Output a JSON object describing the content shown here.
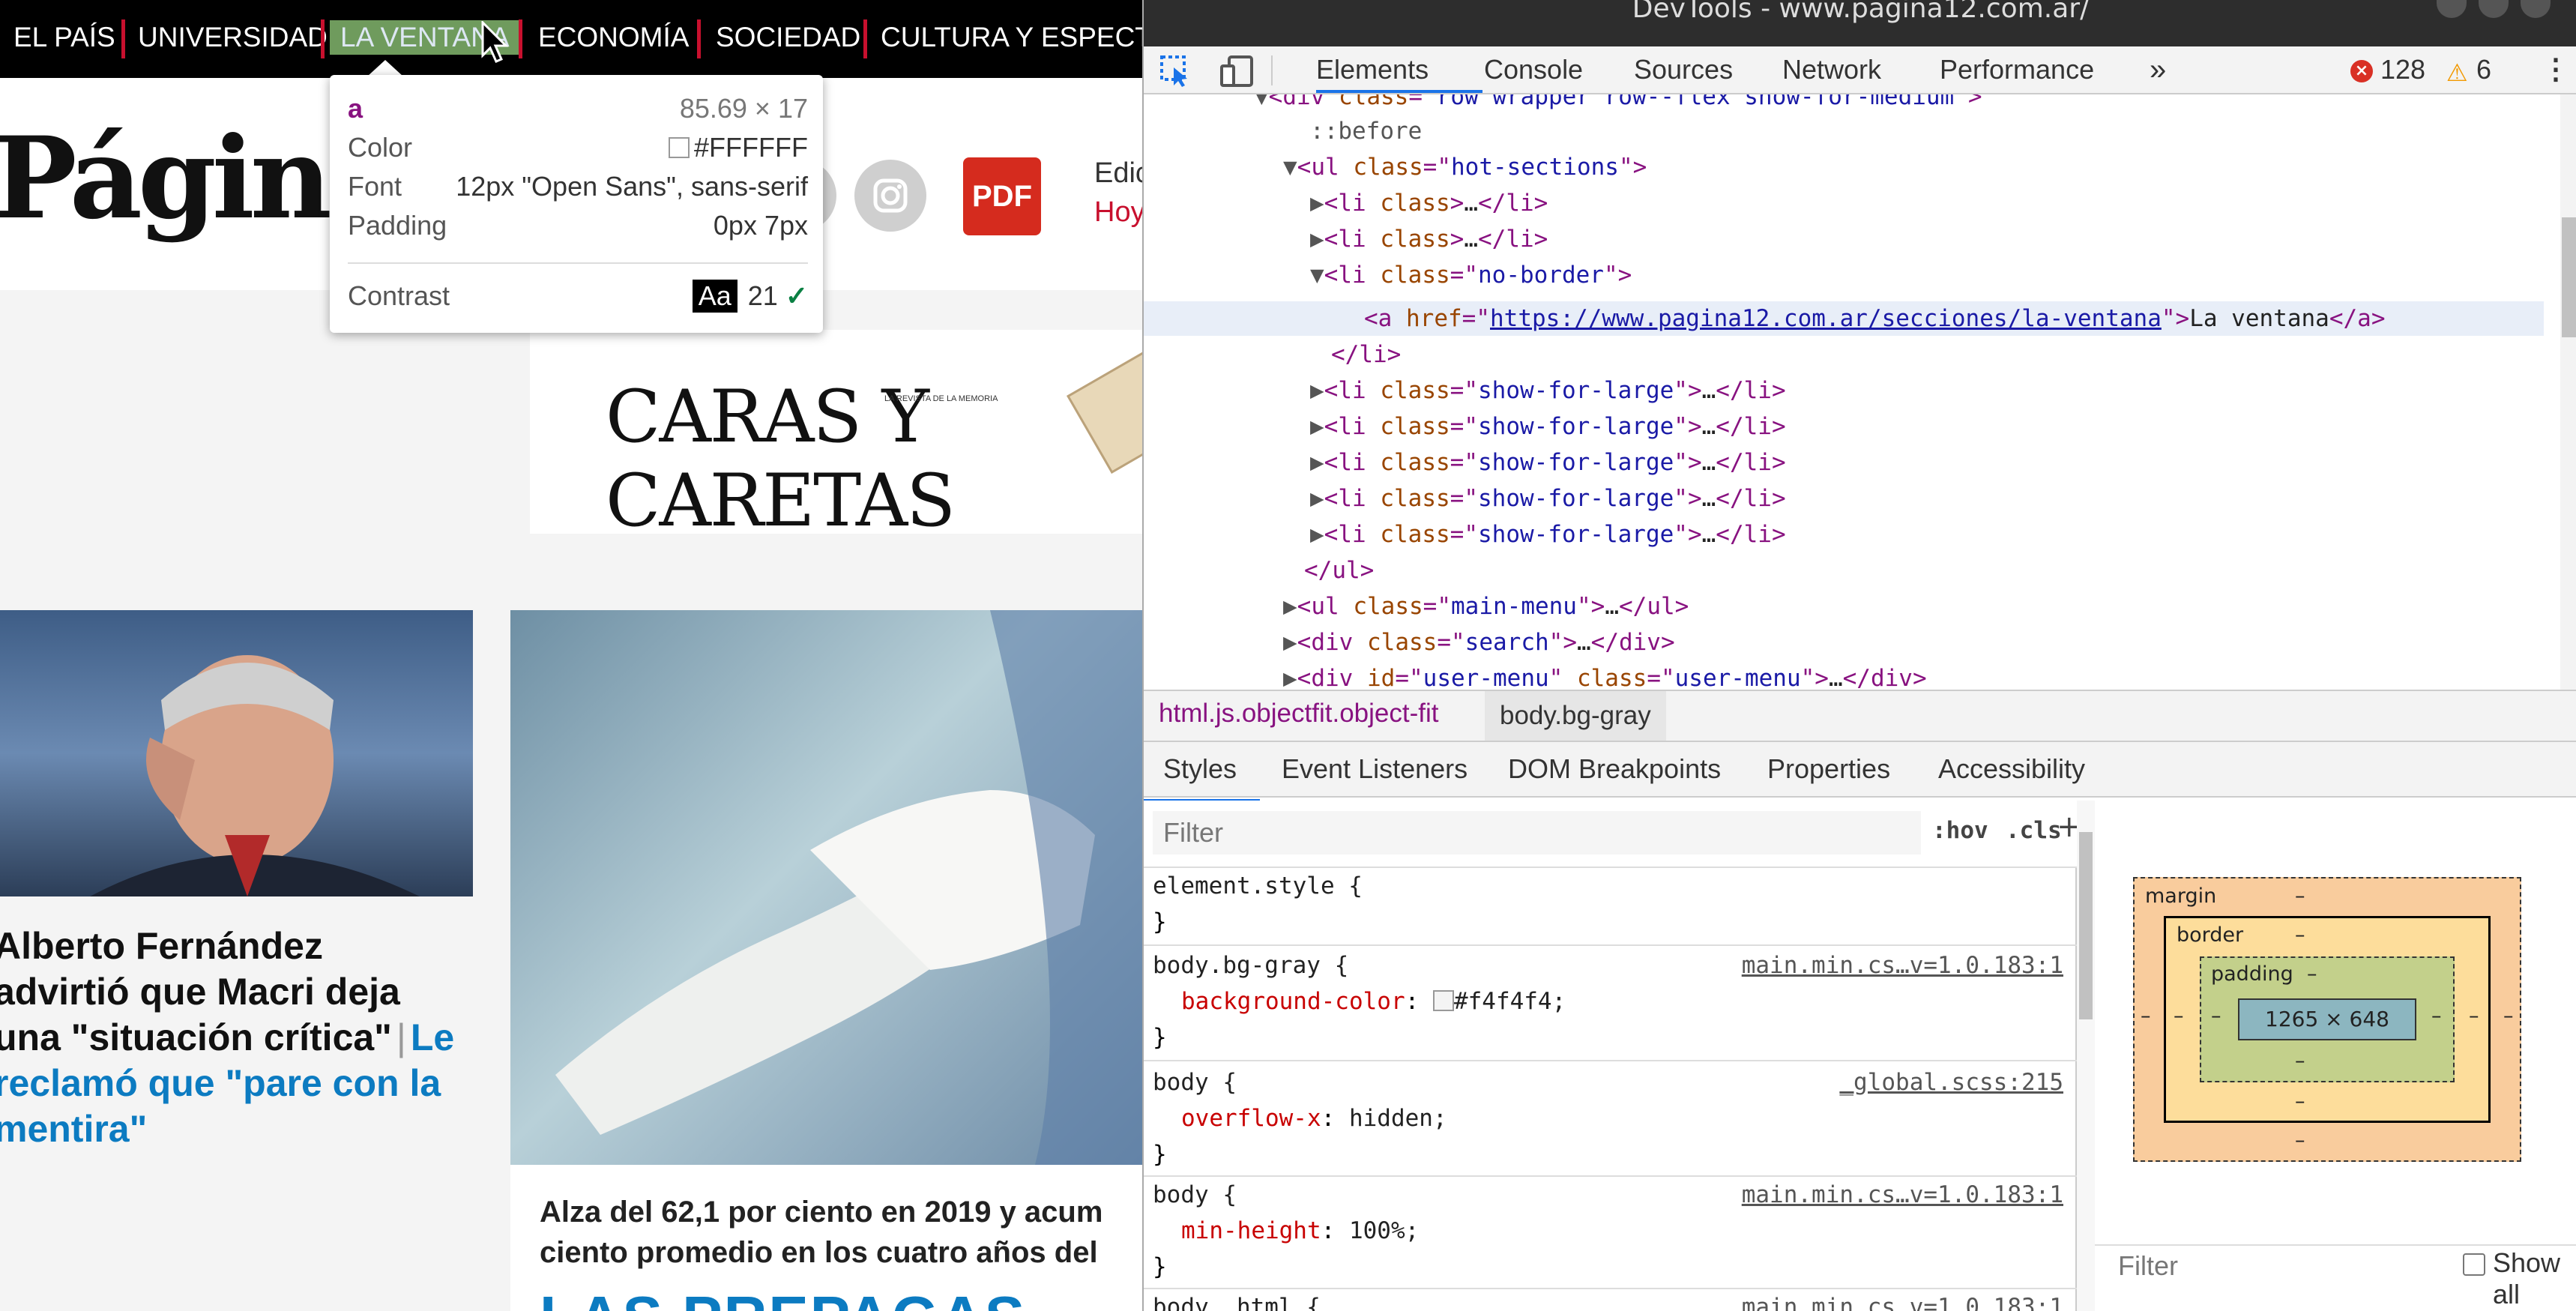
{
  "nav": {
    "items": [
      "EL PAÍS",
      "UNIVERSIDAD",
      "LA VENTANA",
      "ECONOMÍA",
      "SOCIEDAD",
      "CULTURA Y ESPECTÁ"
    ]
  },
  "masthead": {
    "logo": "Págin",
    "pdf_label": "PDF",
    "edition_label": "Edic",
    "edition_date": "Hoy"
  },
  "ad": {
    "brand": "CARAS Y CARETAS",
    "tagline": "LA REVISTA DE LA MEMORIA"
  },
  "articles": [
    {
      "headline": "Alberto Fernández advirtió que Macri deja una \"situación crítica\"",
      "related": "Le reclamó que \"pare con la mentira\""
    },
    {
      "lede": "Alza del 62,1 por ciento en 2019 y acum",
      "lede2": "ciento promedio en los cuatro años del",
      "headline": "LAS PREPAGAS"
    }
  ],
  "tooltip": {
    "tag": "a",
    "size": "85.69 × 17",
    "color_label": "Color",
    "color_value": "#FFFFFF",
    "font_label": "Font",
    "font_value": "12px \"Open Sans\", sans-serif",
    "padding_label": "Padding",
    "padding_value": "0px 7px",
    "contrast_label": "Contrast",
    "contrast_sample": "Aa",
    "contrast_value": "21"
  },
  "devtools": {
    "title": "DevTools - www.pagina12.com.ar/",
    "tabs": [
      "Elements",
      "Console",
      "Sources",
      "Network",
      "Performance"
    ],
    "more_tabs": "»",
    "error_count": "128",
    "warning_count": "6",
    "dom": {
      "line0_tag": "div",
      "line0_attr": "class",
      "line0_val": "row wrapper row--flex show-for-medium",
      "line1": "::before",
      "line2_tag": "ul",
      "line2_attr": "class",
      "line2_val": "hot-sections",
      "li_tag": "li",
      "li_attr": "class",
      "li_ellipsis": "…",
      "li_open_nb": "no-border",
      "a_tag": "a",
      "a_attr": "href",
      "a_href": "https://www.pagina12.com.ar/secciones/la-ventana",
      "a_text": "La ventana",
      "li_close": "</li>",
      "show_for_large": "show-for-large",
      "ul_close": "</ul>",
      "main_menu_val": "main-menu",
      "search_val": "search",
      "user_menu_id": "user-menu",
      "user_menu_class": "user-menu"
    },
    "breadcrumbs": [
      "html.js.objectfit.object-fit",
      "body.bg-gray"
    ],
    "subtabs": [
      "Styles",
      "Event Listeners",
      "DOM Breakpoints",
      "Properties",
      "Accessibility"
    ],
    "styles": {
      "filter_placeholder": "Filter",
      "hov": ":hov",
      "cls": ".cls",
      "plus": "+",
      "rules": [
        {
          "selector": "element.style {",
          "prop": "",
          "value": "",
          "source": ""
        },
        {
          "selector": "body.bg-gray {",
          "prop": "background-color",
          "value": "#f4f4f4;",
          "source": "main.min.cs…v=1.0.183:1"
        },
        {
          "selector": "body {",
          "prop": "overflow-x",
          "value": "hidden;",
          "source": "_global.scss:215"
        },
        {
          "selector": "body {",
          "prop": "min-height",
          "value": "100%;",
          "source": "main.min.cs…v=1.0.183:1"
        },
        {
          "selector": "body, html {",
          "prop": "",
          "value": "",
          "source": "main.min.cs…v=1.0.183:1"
        }
      ],
      "close_brace": "}"
    },
    "boxmodel": {
      "margin_label": "margin",
      "border_label": "border",
      "padding_label": "padding",
      "dash": "–",
      "content_size": "1265 × 648",
      "filter_label": "Filter",
      "show_all_label": "Show all"
    }
  },
  "colors": {
    "nav_bg": "#000000",
    "accent_red": "#c8102e",
    "link_blue": "#0c7bc1",
    "devtools_accent": "#1a73e8"
  }
}
